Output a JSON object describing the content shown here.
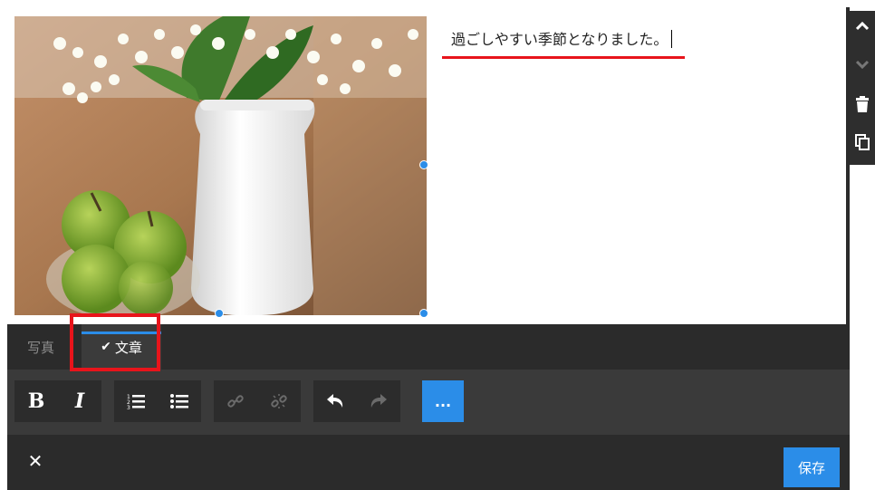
{
  "editor": {
    "text_content": "過ごしやすい季節となりました。"
  },
  "tabs": [
    {
      "label": "写真",
      "active": false
    },
    {
      "label": "文章",
      "active": true
    }
  ],
  "toolbar": {
    "bold_label": "B",
    "italic_label": "I",
    "more_label": "..."
  },
  "bottom_bar": {
    "close_label": "✕",
    "save_label": "保存"
  },
  "colors": {
    "accent": "#2b8de8",
    "highlight": "#e8141b",
    "panel": "#2b2b2b"
  },
  "icons": [
    "chevron-up-icon",
    "chevron-down-icon",
    "trash-icon",
    "duplicate-icon",
    "check-icon",
    "ordered-list-icon",
    "bullet-list-icon",
    "link-icon",
    "unlink-icon",
    "undo-icon",
    "redo-icon",
    "close-icon"
  ]
}
